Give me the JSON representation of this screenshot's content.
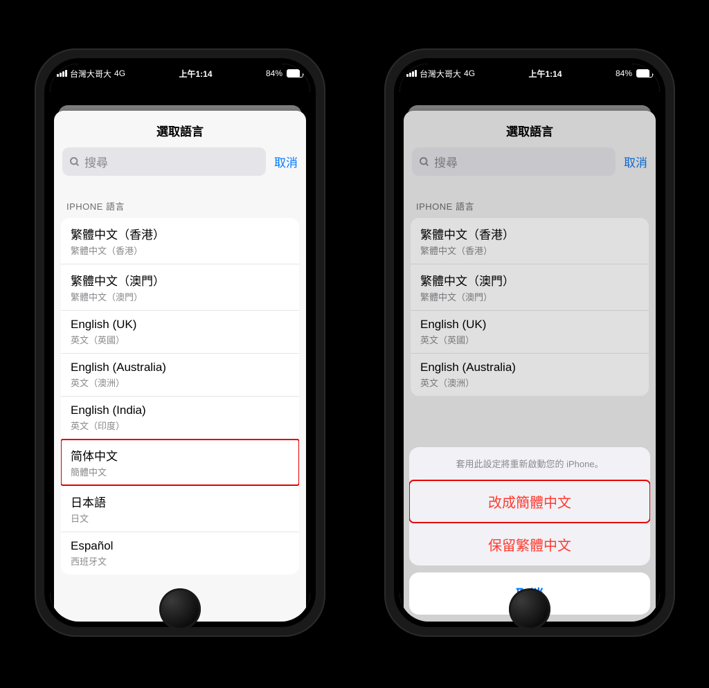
{
  "status": {
    "carrier": "台灣大哥大",
    "network": "4G",
    "time": "上午1:14",
    "battery_pct": "84%",
    "battery_fill_pct": 84
  },
  "modal": {
    "title": "選取語言",
    "search_placeholder": "搜尋",
    "cancel": "取消",
    "section_header": "IPHONE 語言"
  },
  "languages": [
    {
      "title": "繁體中文（香港）",
      "sub": "繁體中文（香港）"
    },
    {
      "title": "繁體中文（澳門）",
      "sub": "繁體中文（澳門）"
    },
    {
      "title": "English (UK)",
      "sub": "英文（英國）"
    },
    {
      "title": "English (Australia)",
      "sub": "英文（澳洲）"
    },
    {
      "title": "English (India)",
      "sub": "英文（印度）"
    },
    {
      "title": "简体中文",
      "sub": "簡體中文"
    },
    {
      "title": "日本語",
      "sub": "日文"
    },
    {
      "title": "Español",
      "sub": "西班牙文"
    }
  ],
  "sheet": {
    "note": "套用此設定將重新啟動您的 iPhone。",
    "change": "改成簡體中文",
    "keep": "保留繁體中文",
    "cancel": "取消"
  }
}
